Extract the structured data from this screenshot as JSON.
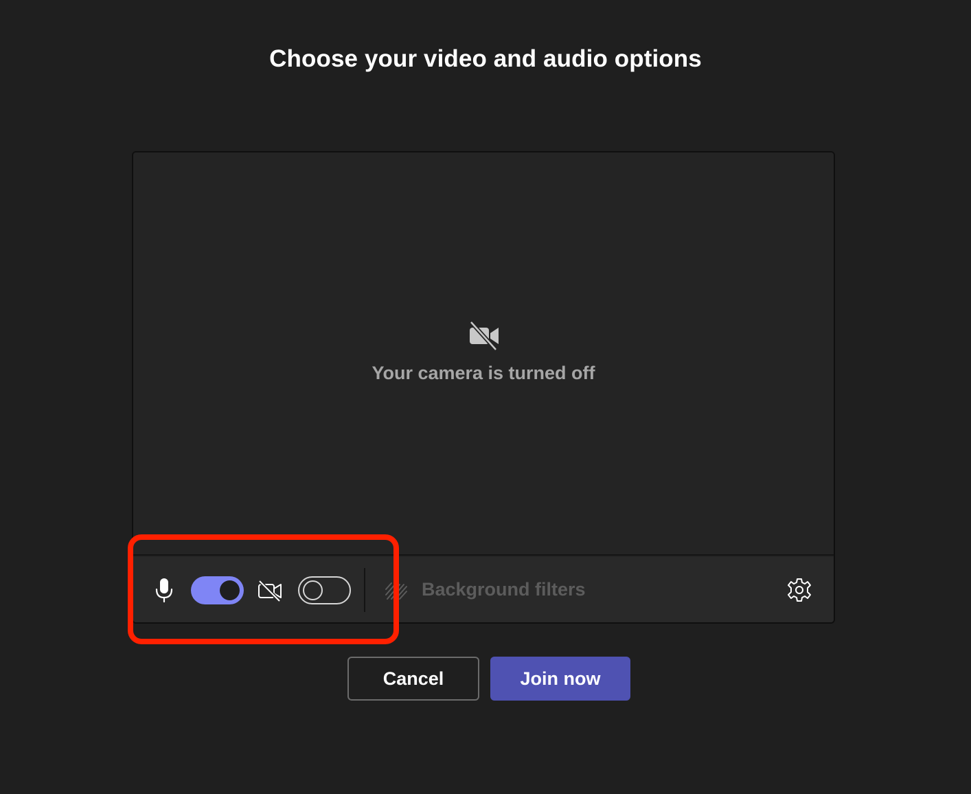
{
  "page": {
    "title": "Choose your video and audio options"
  },
  "preview": {
    "camera_off_text": "Your camera is turned off",
    "camera_off_icon": "video-off-icon"
  },
  "controls": {
    "mic_icon": "microphone-icon",
    "mic_toggle_state": "on",
    "camera_icon": "video-off-icon",
    "camera_toggle_state": "off",
    "background_filters_icon": "background-blur-icon",
    "background_filters_label": "Background filters",
    "settings_icon": "gear-icon"
  },
  "actions": {
    "cancel_label": "Cancel",
    "join_label": "Join now"
  },
  "colors": {
    "background": "#1f1f1f",
    "toggle_on": "#7f85f5",
    "join_button": "#4f52b2",
    "highlight": "#ff2000",
    "muted_text": "#a6a6a6",
    "disabled_text": "#5c5c5c"
  }
}
